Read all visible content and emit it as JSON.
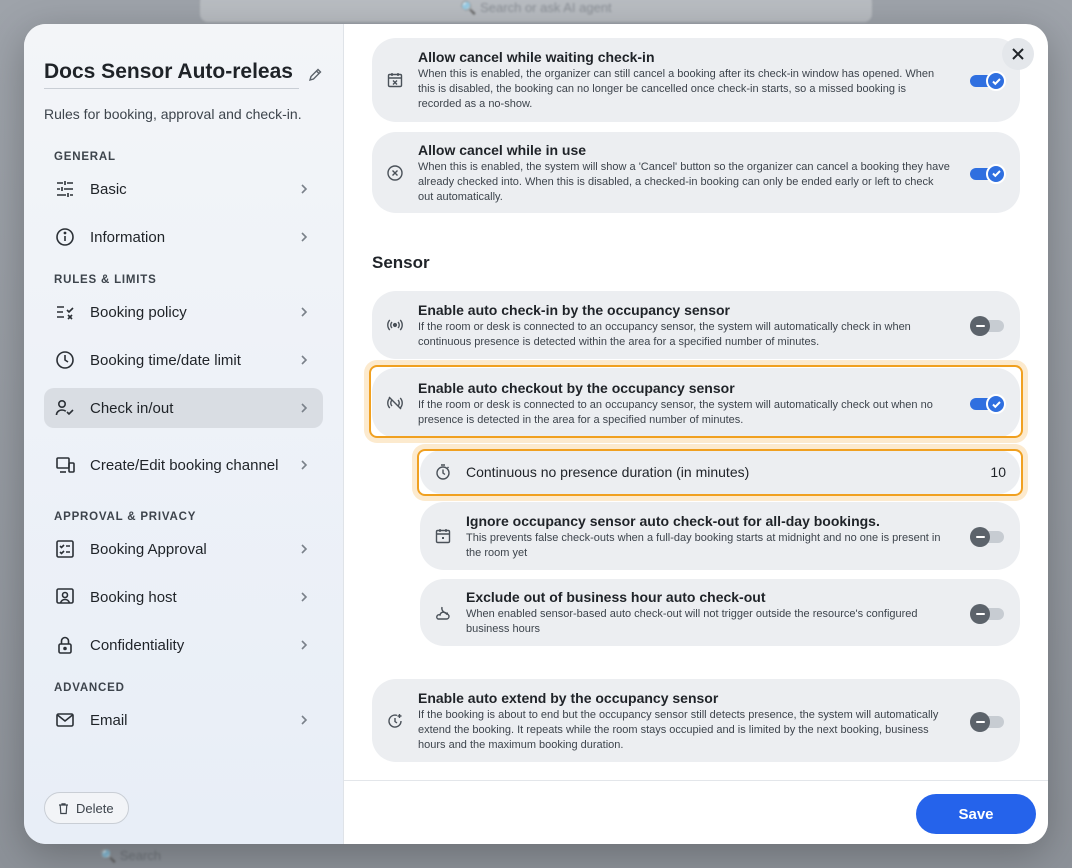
{
  "background": {
    "search_placeholder": "Search or ask AI agent",
    "bottom_text": "Search"
  },
  "sidebar": {
    "title": "Docs Sensor Auto-releas",
    "subtitle": "Rules for booking, approval and check-in.",
    "sections": {
      "general": "GENERAL",
      "rules": "RULES & LIMITS",
      "approval": "APPROVAL & PRIVACY",
      "advanced": "ADVANCED"
    },
    "items": {
      "basic": "Basic",
      "information": "Information",
      "booking_policy": "Booking policy",
      "booking_time": "Booking time/date limit",
      "check_in_out": "Check in/out",
      "create_edit": "Create/Edit booking channel",
      "booking_approval": "Booking Approval",
      "booking_host": "Booking host",
      "confidentiality": "Confidentiality",
      "email": "Email"
    },
    "active_item": "Check in/out",
    "delete_label": "Delete"
  },
  "main": {
    "cancel_waiting": {
      "title": "Allow cancel while waiting check-in",
      "desc": "When this is enabled, the organizer can still cancel a booking after its check-in window has opened. When this is disabled, the booking can no longer be cancelled once check-in starts, so a missed booking is recorded as a no-show.",
      "enabled": true
    },
    "cancel_in_use": {
      "title": "Allow cancel while in use",
      "desc": "When this is enabled, the system will show a 'Cancel' button so the organizer can cancel a booking they have already checked into. When this is disabled, a checked-in booking can only be ended early or left to check out automatically.",
      "enabled": true
    },
    "sensor_heading": "Sensor",
    "auto_checkin": {
      "title": "Enable auto check-in by the occupancy sensor",
      "desc": "If the room or desk is connected to an occupancy sensor, the system will automatically check in when continuous presence is detected within the area for a specified number of minutes.",
      "enabled": false
    },
    "auto_checkout": {
      "title": "Enable auto checkout by the occupancy sensor",
      "desc": "If the room or desk is connected to an occupancy sensor, the system will automatically check out when no presence is detected in the area for a specified number of minutes.",
      "enabled": true
    },
    "no_presence_duration": {
      "title": "Continuous no presence duration (in minutes)",
      "value": "10"
    },
    "ignore_all_day": {
      "title": "Ignore occupancy sensor auto check-out for all-day bookings.",
      "desc": "This prevents false check-outs when a full-day booking starts at midnight and no one is present in the room yet",
      "enabled": false
    },
    "exclude_business_hours": {
      "title": "Exclude out of business hour auto check-out",
      "desc": "When enabled sensor-based auto check-out will not trigger outside the resource's configured business hours",
      "enabled": false
    },
    "auto_extend": {
      "title": "Enable auto extend by the occupancy sensor",
      "desc": "If the booking is about to end but the occupancy sensor still detects presence, the system will automatically extend the booking. It repeats while the room stays occupied and is limited by the next booking, business hours and the maximum booking duration.",
      "enabled": false
    },
    "save_label": "Save"
  },
  "colors": {
    "accent": "#2563eb",
    "toggle_on": "#2f6fe0",
    "highlight": "#f0a020"
  }
}
